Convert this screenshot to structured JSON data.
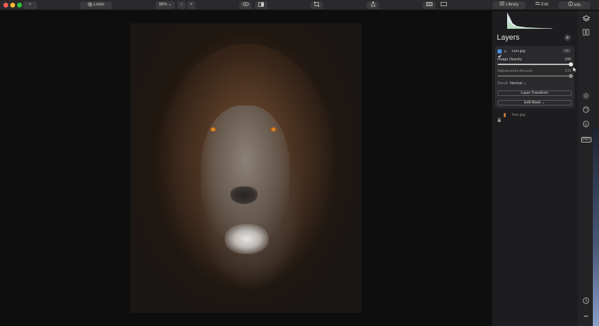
{
  "toolbar": {
    "looks_label": "Looks",
    "zoom_value": "38% ⌄",
    "zoom_out": "−",
    "zoom_in": "+",
    "add_label": "+"
  },
  "tabs": {
    "library": "Library",
    "edit": "Edit",
    "info": "Info"
  },
  "layers": {
    "title": "Layers",
    "add": "+",
    "active_layer": {
      "name": "Lion.jpg",
      "more": "•••",
      "opacity_label": "Image Opacity",
      "opacity_value": "100",
      "opacity_fraction": 1.0,
      "adjust_label": "Adjustments Amount",
      "adjust_value": "100",
      "adjust_fraction": 1.0,
      "blend_label": "Blend:",
      "blend_value": "Normal ⌄",
      "transform_button": "Layer Transform",
      "mask_button": "Edit Mask ⌄"
    },
    "other_layer": {
      "name": "face.jpg"
    }
  },
  "side_icons": [
    "layers-icon",
    "compare-icon",
    "sun-icon",
    "palette-icon",
    "face-icon",
    "pro-icon",
    "history-icon",
    "more-icon"
  ],
  "side_pro_label": "PRO",
  "side_more_label": "•••",
  "colors": {
    "accent": "#4a90e2",
    "panel": "#1d1d1f"
  }
}
